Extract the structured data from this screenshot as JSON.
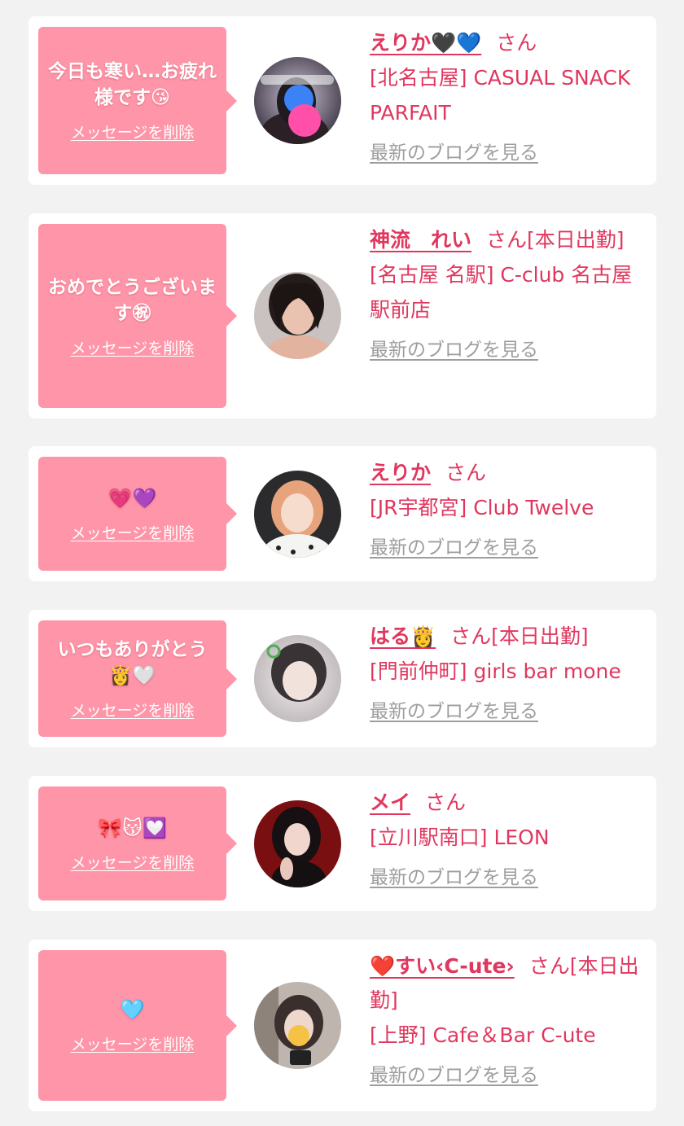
{
  "entries": [
    {
      "message": "今日も寒い…お疲れ様です😘",
      "delete_label": "メッセージを削除",
      "name": "えりか🖤💙",
      "honorific": "さん",
      "attendance": "",
      "shop": "[北名古屋] CASUAL SNACK PARFAIT",
      "blog_label": "最新のブログを見る"
    },
    {
      "message": "おめでとうございます㊗",
      "delete_label": "メッセージを削除",
      "name": "神流　れい",
      "honorific": "さん",
      "attendance": "[本日出勤]",
      "shop": "[名古屋 名駅] C-club 名古屋駅前店",
      "blog_label": "最新のブログを見る"
    },
    {
      "message": "💗💜",
      "delete_label": "メッセージを削除",
      "name": "えりか",
      "honorific": "さん",
      "attendance": "",
      "shop": "[JR宇都宮] Club Twelve",
      "blog_label": "最新のブログを見る"
    },
    {
      "message": "いつもありがとう👸🤍",
      "delete_label": "メッセージを削除",
      "name": "はる👸",
      "honorific": "さん",
      "attendance": "[本日出勤]",
      "shop": "[門前仲町] girls bar mone",
      "blog_label": "最新のブログを見る"
    },
    {
      "message": "🎀😽💟",
      "delete_label": "メッセージを削除",
      "name": "メイ",
      "honorific": "さん",
      "attendance": "",
      "shop": "[立川駅南口] LEON",
      "blog_label": "最新のブログを見る"
    },
    {
      "message": "🩵",
      "delete_label": "メッセージを削除",
      "name": "❤️すい‹C-ute›",
      "honorific": "さん",
      "attendance": "[本日出勤]",
      "shop": "[上野] Cafe＆Bar C-ute",
      "blog_label": "最新のブログを見る"
    }
  ],
  "colors": {
    "page_background": "#f2f2f2",
    "card_background": "#ffffff",
    "bubble": "#ff95a8",
    "accent_text": "#e0375e",
    "link_gray": "#9e9e9e"
  }
}
